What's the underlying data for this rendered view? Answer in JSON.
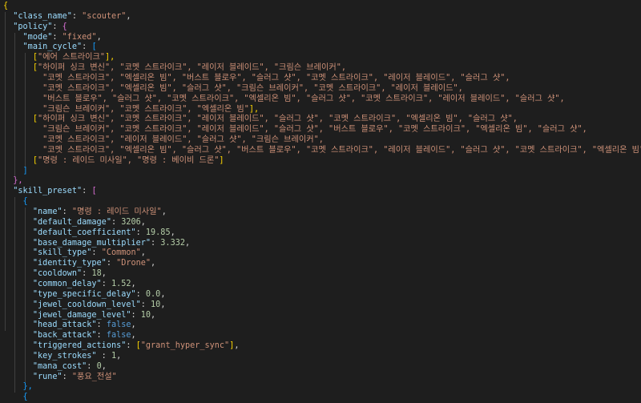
{
  "editor": {
    "language": "json",
    "colors": {
      "background": "#1e1e1e",
      "key": "#9cdcfe",
      "string": "#ce9178",
      "number": "#b5cea8",
      "keyword": "#569cd6",
      "bracket_level_1": "#ffd700",
      "bracket_level_2": "#da70d6",
      "bracket_level_3": "#179fff",
      "indent_guide": "#404040"
    },
    "lines": [
      [
        [
          "{",
          "b1"
        ]
      ],
      [
        [
          "  ",
          ""
        ],
        [
          "\"class_name\"",
          "key"
        ],
        [
          ": ",
          "p"
        ],
        [
          "\"scouter\"",
          "str"
        ],
        [
          ",",
          "p"
        ]
      ],
      [
        [
          "  ",
          ""
        ],
        [
          "\"policy\"",
          "key"
        ],
        [
          ": ",
          "p"
        ],
        [
          "{",
          "b2"
        ]
      ],
      [
        [
          "    ",
          ""
        ],
        [
          "\"mode\"",
          "key"
        ],
        [
          ": ",
          "p"
        ],
        [
          "\"fixed\"",
          "str"
        ],
        [
          ",",
          "p"
        ]
      ],
      [
        [
          "    ",
          ""
        ],
        [
          "\"main_cycle\"",
          "key"
        ],
        [
          ": ",
          "p"
        ],
        [
          "[",
          "b3"
        ]
      ],
      [
        [
          "      ",
          ""
        ],
        [
          "[",
          "b1"
        ],
        [
          "\"에어 스트라이크\"",
          "str"
        ],
        [
          "],",
          "b1"
        ]
      ],
      [
        [
          "      ",
          ""
        ],
        [
          "[",
          "b1"
        ],
        [
          "\"하이퍼 싱크 변신\", \"코멧 스트라이크\", \"레이저 블레이드\", \"크림슨 브레이커\",",
          "str"
        ]
      ],
      [
        [
          "        ",
          ""
        ],
        [
          "\"코멧 스트라이크\", \"엑셀리온 빔\", \"버스트 블로우\", \"슬러그 샷\", \"코멧 스트라이크\", \"레이저 블레이드\", \"슬러그 샷\",",
          "str"
        ]
      ],
      [
        [
          "        ",
          ""
        ],
        [
          "\"코멧 스트라이크\", \"엑셀리온 빔\", \"슬러그 샷\", \"크림슨 브레이커\", \"코멧 스트라이크\", \"레이저 블레이드\",",
          "str"
        ]
      ],
      [
        [
          "        ",
          ""
        ],
        [
          "\"버스트 블로우\", \"슬러그 샷\", \"코멧 스트라이크\", \"엑셀리온 빔\", \"슬러그 샷\", \"코멧 스트라이크\", \"레이저 블레이드\", \"슬러그 샷\",",
          "str"
        ]
      ],
      [
        [
          "        ",
          ""
        ],
        [
          "\"크림슨 브레이커\", \"코멧 스트라이크\", \"엑셀리온 빔\"",
          "str"
        ],
        [
          "],",
          "b1"
        ]
      ],
      [
        [
          "      ",
          ""
        ],
        [
          "[",
          "b1"
        ],
        [
          "\"하이퍼 싱크 변신\", \"코멧 스트라이크\", \"레이저 블레이드\", \"슬러그 샷\", \"코멧 스트라이크\", \"엑셀리온 빔\", \"슬러그 샷\",",
          "str"
        ]
      ],
      [
        [
          "        ",
          ""
        ],
        [
          "\"크림슨 브레이커\", \"코멧 스트라이크\", \"레이저 블레이드\", \"슬러그 샷\", \"버스트 블로우\", \"코멧 스트라이크\", \"엑셀리온 빔\", \"슬러그 샷\",",
          "str"
        ]
      ],
      [
        [
          "        ",
          ""
        ],
        [
          "\"코멧 스트라이크\", \"레이저 블레이드\", \"슬러그 샷\", \"크림슨 브레이커\",",
          "str"
        ]
      ],
      [
        [
          "        ",
          ""
        ],
        [
          "\"코멧 스트라이크\", \"엑셀리온 빔\", \"슬러그 샷\", \"버스트 블로우\", \"코멧 스트라이크\", \"레이저 블레이드\", \"슬러그 샷\", \"코멧 스트라이크\", \"엑셀리온 빔\"",
          "str"
        ],
        [
          "],",
          "b1"
        ]
      ],
      [
        [
          "      ",
          ""
        ],
        [
          "[",
          "b1"
        ],
        [
          "\"명령 : 레이드 미사일\", \"명령 : 베이비 드론\"",
          "str"
        ],
        [
          "]",
          "b1"
        ]
      ],
      [
        [
          "    ",
          ""
        ],
        [
          "]",
          "b3"
        ]
      ],
      [
        [
          "  ",
          ""
        ],
        [
          "},",
          "b2"
        ]
      ],
      [
        [
          "  ",
          ""
        ],
        [
          "\"skill_preset\"",
          "key"
        ],
        [
          ": ",
          "p"
        ],
        [
          "[",
          "b2"
        ]
      ],
      [
        [
          "    ",
          ""
        ],
        [
          "{",
          "b3"
        ]
      ],
      [
        [
          "      ",
          ""
        ],
        [
          "\"name\"",
          "key"
        ],
        [
          ": ",
          "p"
        ],
        [
          "\"명령 : 레이드 미사일\"",
          "str"
        ],
        [
          ",",
          "p"
        ]
      ],
      [
        [
          "      ",
          ""
        ],
        [
          "\"default_damage\"",
          "key"
        ],
        [
          ": ",
          "p"
        ],
        [
          "3206",
          "num"
        ],
        [
          ",",
          "p"
        ]
      ],
      [
        [
          "      ",
          ""
        ],
        [
          "\"default_coefficient\"",
          "key"
        ],
        [
          ": ",
          "p"
        ],
        [
          "19.85",
          "num"
        ],
        [
          ",",
          "p"
        ]
      ],
      [
        [
          "      ",
          ""
        ],
        [
          "\"base_damage_multiplier\"",
          "key"
        ],
        [
          ": ",
          "p"
        ],
        [
          "3.332",
          "num"
        ],
        [
          ",",
          "p"
        ]
      ],
      [
        [
          "      ",
          ""
        ],
        [
          "\"skill_type\"",
          "key"
        ],
        [
          ": ",
          "p"
        ],
        [
          "\"Common\"",
          "str"
        ],
        [
          ",",
          "p"
        ]
      ],
      [
        [
          "      ",
          ""
        ],
        [
          "\"identity_type\"",
          "key"
        ],
        [
          ": ",
          "p"
        ],
        [
          "\"Drone\"",
          "str"
        ],
        [
          ",",
          "p"
        ]
      ],
      [
        [
          "      ",
          ""
        ],
        [
          "\"cooldown\"",
          "key"
        ],
        [
          ": ",
          "p"
        ],
        [
          "18",
          "num"
        ],
        [
          ",",
          "p"
        ]
      ],
      [
        [
          "      ",
          ""
        ],
        [
          "\"common_delay\"",
          "key"
        ],
        [
          ": ",
          "p"
        ],
        [
          "1.52",
          "num"
        ],
        [
          ",",
          "p"
        ]
      ],
      [
        [
          "      ",
          ""
        ],
        [
          "\"type_specific_delay\"",
          "key"
        ],
        [
          ": ",
          "p"
        ],
        [
          "0.0",
          "num"
        ],
        [
          ",",
          "p"
        ]
      ],
      [
        [
          "      ",
          ""
        ],
        [
          "\"jewel_cooldown_level\"",
          "key"
        ],
        [
          ": ",
          "p"
        ],
        [
          "10",
          "num"
        ],
        [
          ",",
          "p"
        ]
      ],
      [
        [
          "      ",
          ""
        ],
        [
          "\"jewel_damage_level\"",
          "key"
        ],
        [
          ": ",
          "p"
        ],
        [
          "10",
          "num"
        ],
        [
          ",",
          "p"
        ]
      ],
      [
        [
          "      ",
          ""
        ],
        [
          "\"head_attack\"",
          "key"
        ],
        [
          ": ",
          "p"
        ],
        [
          "false",
          "kw"
        ],
        [
          ",",
          "p"
        ]
      ],
      [
        [
          "      ",
          ""
        ],
        [
          "\"back_attack\"",
          "key"
        ],
        [
          ": ",
          "p"
        ],
        [
          "false",
          "kw"
        ],
        [
          ",",
          "p"
        ]
      ],
      [
        [
          "      ",
          ""
        ],
        [
          "\"triggered_actions\"",
          "key"
        ],
        [
          ": ",
          "p"
        ],
        [
          "[",
          "b1"
        ],
        [
          "\"grant_hyper_sync\"",
          "str"
        ],
        [
          "]",
          "b1"
        ],
        [
          ",",
          "p"
        ]
      ],
      [
        [
          "      ",
          ""
        ],
        [
          "\"key_strokes\"",
          "key"
        ],
        [
          " : ",
          "p"
        ],
        [
          "1",
          "num"
        ],
        [
          ",",
          "p"
        ]
      ],
      [
        [
          "      ",
          ""
        ],
        [
          "\"mana_cost\"",
          "key"
        ],
        [
          ": ",
          "p"
        ],
        [
          "0",
          "num"
        ],
        [
          ",",
          "p"
        ]
      ],
      [
        [
          "      ",
          ""
        ],
        [
          "\"rune\"",
          "key"
        ],
        [
          ": ",
          "p"
        ],
        [
          "\"풍요_전설\"",
          "str"
        ]
      ],
      [
        [
          "    ",
          ""
        ],
        [
          "},",
          "b3"
        ]
      ],
      [
        [
          "    ",
          ""
        ],
        [
          "{",
          "b3"
        ]
      ]
    ]
  }
}
